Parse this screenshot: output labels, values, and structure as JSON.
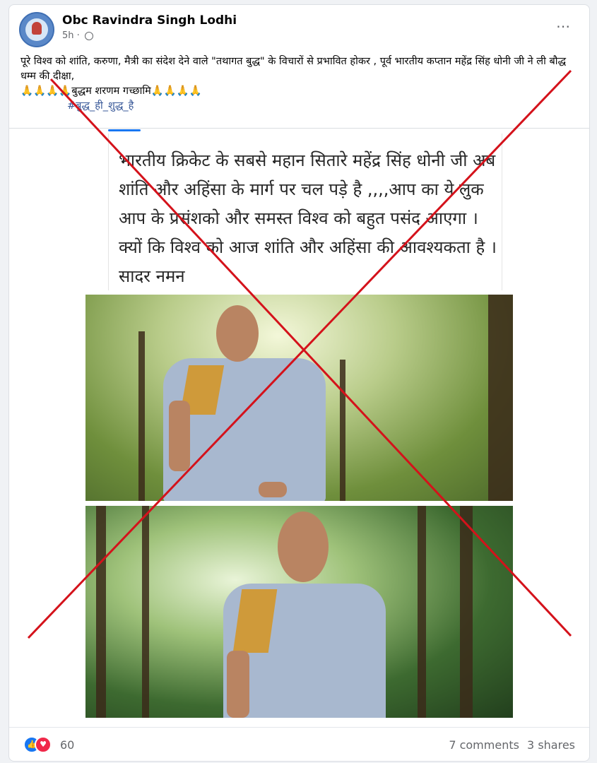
{
  "post": {
    "author": "Obc Ravindra Singh Lodhi",
    "time": "5h",
    "more_icon": "⋯",
    "caption_line1": "पूरे विश्व को शांति, करुणा, मैत्री का संदेश देने वाले \"तथागत बुद्ध\" के विचारों से प्रभावित होकर , पूर्व भारतीय कप्तान महेंद्र सिंह धोनी जी ने ली बौद्ध धम्म की दीक्षा,",
    "caption_line2": "🙏🙏🙏🙏बुद्धम शरणम गच्छामि🙏🙏🙏🙏",
    "hashtag": "#बुद्ध_ही_शुद्ध_है"
  },
  "image_text": "भारतीय क्रिकेट के सबसे महान सितारे महेंद्र सिंह धोनी जी अब शांति और अहिंसा के मार्ग पर चल पड़े है ,,,,आप का ये लुक आप के प्रसंशको और समस्त विश्व को बहुत पसंद आएगा । क्यों कि विश्व को आज शांति और अहिंसा की आवश्यकता है । सादर नमन",
  "footer": {
    "reaction_count": "60",
    "comments": "7 comments",
    "shares": "3 shares"
  },
  "icons": {
    "like": "👍",
    "love": "♥"
  },
  "colors": {
    "cross": "#d4121b",
    "link": "#385898",
    "like": "#1877f2",
    "love": "#f02849"
  }
}
